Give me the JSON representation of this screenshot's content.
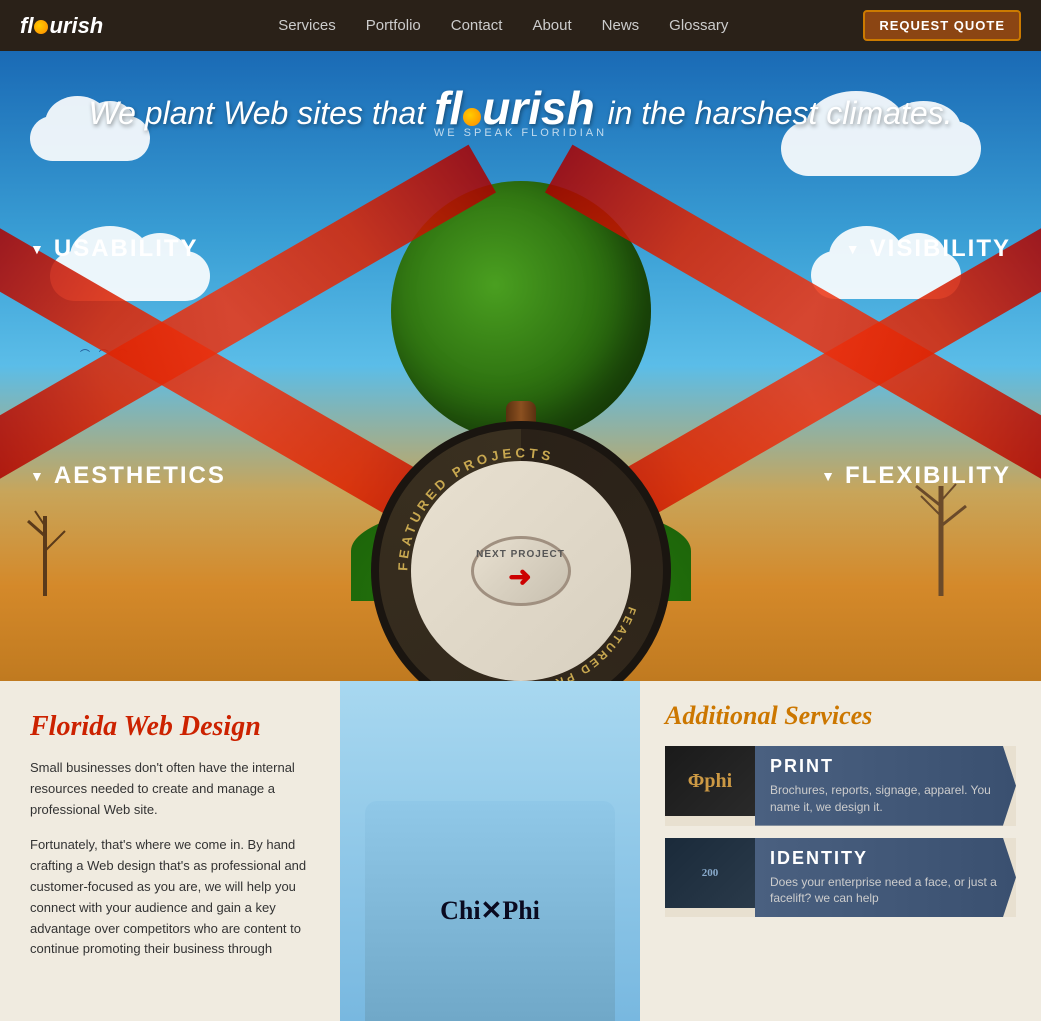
{
  "nav": {
    "logo": "fl•urish",
    "links": [
      "Services",
      "Portfolio",
      "Contact",
      "About",
      "News",
      "Glossary"
    ],
    "cta": "REQUEST QUOTE"
  },
  "hero": {
    "headline_before": "We plant Web sites that",
    "headline_logo": "flourish",
    "headline_after": "in the harshest climates.",
    "subtitle": "WE SPEAK FLORIDIAN",
    "ribbons": {
      "usability": "USABILITY",
      "visibility": "VISIBILITY",
      "aesthetics": "AESTHETICS",
      "flexibility": "FLEXIBILITY"
    },
    "featured": {
      "outer_text": "FEATURED PROJECTS",
      "next_label": "NEXT PROJECT"
    }
  },
  "florida": {
    "title": "Florida Web Design",
    "paragraph1": "Small businesses don't often have the internal resources needed to create and manage a professional Web site.",
    "paragraph2": "Fortunately, that's where we come in. By hand crafting a Web design that's as professional and customer-focused as you are, we will help you connect with your audience and gain a key advantage over competitors who are content to continue promoting their business through"
  },
  "additional": {
    "title": "Additional Services",
    "services": [
      {
        "name": "PRINT",
        "description": "Brochures, reports, signage, apparel. You name it, we design it."
      },
      {
        "name": "IDENTITY",
        "description": "Does your enterprise need a face, or just a facelift? we can help"
      }
    ]
  }
}
